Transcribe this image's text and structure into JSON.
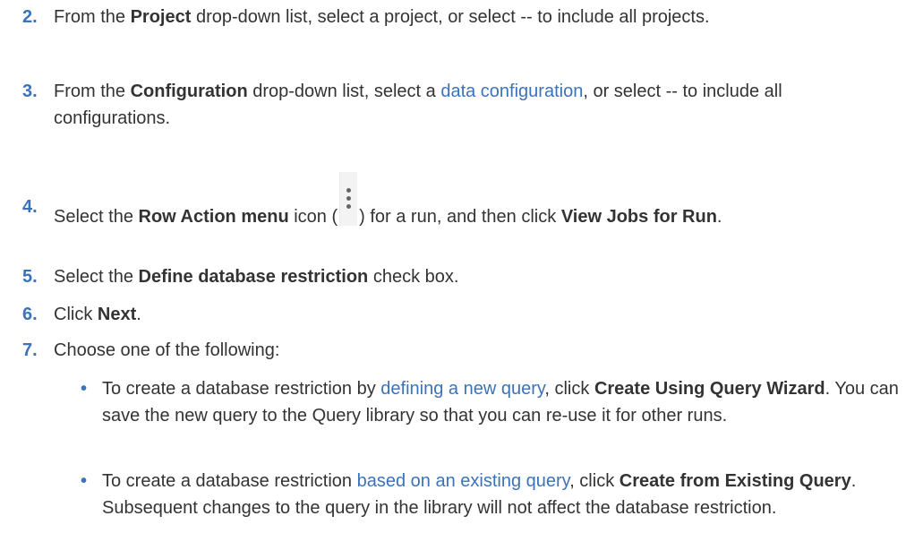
{
  "steps": [
    {
      "number": "2.",
      "p1": "From the ",
      "bold1": "Project",
      "p2": " drop-down list, select a project, or select -- to include all projects."
    },
    {
      "number": "3.",
      "p1": "From the ",
      "bold1": "Configuration",
      "p2": " drop-down list, select a ",
      "link1": "data configuration",
      "p3": ", or select -- to include all configurations."
    },
    {
      "number": "4.",
      "p1": "Select the ",
      "bold1": "Row Action menu",
      "p2": " icon (",
      "icon": "vertical-ellipsis-icon",
      "p3": ") for a run, and then click ",
      "bold2": "View Jobs for Run",
      "p4": "."
    },
    {
      "number": "5.",
      "p1": "Select the ",
      "bold1": "Define database restriction",
      "p2": " check box."
    },
    {
      "number": "6.",
      "p1": "Click ",
      "bold1": "Next",
      "p2": "."
    },
    {
      "number": "7.",
      "p1": "Choose one of the following:"
    }
  ],
  "bullets": [
    {
      "marker": "•",
      "p1": "To create a database restriction by ",
      "link1": "defining a new query",
      "p2": ", click ",
      "bold1": "Create Using Query Wizard",
      "p3": ". You can save the new query to the Query library so that you can re-use it for other runs."
    },
    {
      "marker": "•",
      "p1": "To create a database restriction ",
      "link1": "based on an existing query",
      "p2": ", click ",
      "bold1": "Create from Existing Query",
      "p3": ". Subsequent changes to the query in the library will not affect the database restriction."
    }
  ],
  "colors": {
    "accent": "#3b73b9",
    "text": "#333333"
  }
}
